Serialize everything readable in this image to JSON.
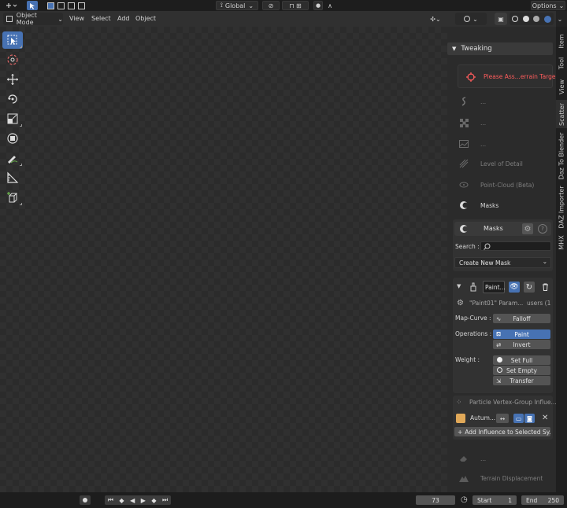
{
  "topbar": {
    "transform_orientation": "Global",
    "options_label": "Options"
  },
  "header": {
    "mode": "Object Mode",
    "menus": [
      "View",
      "Select",
      "Add",
      "Object"
    ]
  },
  "tools": [
    "select-box",
    "cursor",
    "move",
    "rotate",
    "scale",
    "transform",
    "annotate",
    "measure",
    "add-cube"
  ],
  "vertical_tabs": [
    "Item",
    "Tool",
    "View",
    "Scatter",
    "Daz To Blender",
    "DAZ Importer",
    "MHX"
  ],
  "panel": {
    "section_title": "Tweaking",
    "warning_text": "Please Ass...errain Targe",
    "items": [
      {
        "label": "...",
        "icon": "scatter-icon"
      },
      {
        "label": "...",
        "icon": "checker-icon"
      },
      {
        "label": "...",
        "icon": "image-icon"
      },
      {
        "label": "Level of Detail",
        "icon": "lod-icon"
      },
      {
        "label": "Point-Cloud (Beta)",
        "icon": "pointcloud-icon"
      },
      {
        "label": "Masks",
        "icon": "masks-icon"
      }
    ],
    "masks": {
      "title": "Masks",
      "search_label": "Search :",
      "search_value": "",
      "create_dropdown": "Create New Mask",
      "layer_name": "Paint...",
      "params_text": "\"Paint01\" Param...",
      "users_text": "users (1",
      "map_curve_label": "Map-Curve :",
      "falloff_label": "Falloff",
      "operations_label": "Operations :",
      "paint_label": "Paint",
      "invert_label": "Invert",
      "weight_label": "Weight :",
      "set_full_label": "Set Full",
      "set_empty_label": "Set Empty",
      "transfer_label": "Transfer",
      "vg_influence_label": "Particle Vertex-Group Influe...",
      "system_name": "Autum...",
      "system_color": "#e0a858",
      "add_influence_label": "Add Influence to Selected Sy..."
    },
    "after_items": [
      {
        "label": "...",
        "icon": "eraser-icon"
      },
      {
        "label": "Terrain Displacement",
        "icon": "terrain-icon"
      }
    ]
  },
  "timeline": {
    "current_frame": "73",
    "start_label": "Start",
    "start_value": "1",
    "end_label": "End",
    "end_value": "250"
  },
  "colors": {
    "accent": "#4772b3",
    "warning": "#ff5c5c"
  }
}
